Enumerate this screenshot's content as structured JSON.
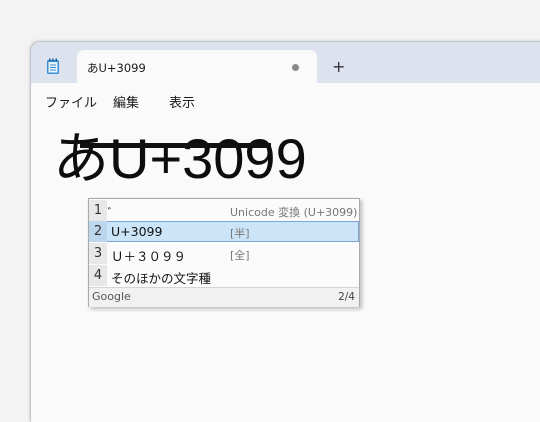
{
  "tab": {
    "title": "あU+3099",
    "new_tab_label": "+"
  },
  "menu": [
    "ファイル",
    "編集",
    "表示"
  ],
  "editor": {
    "committed_text": "あ",
    "composition_text": "U+3099"
  },
  "candidates": [
    {
      "num": "1",
      "text": "゙",
      "note": "Unicode 変換 (U+3099)",
      "selected": false
    },
    {
      "num": "2",
      "text": "U+3099",
      "note": "[半]",
      "selected": true
    },
    {
      "num": "3",
      "text": "Ｕ＋３０９９",
      "note": "[全]",
      "selected": false
    },
    {
      "num": "4",
      "text": "そのほかの文字種",
      "note": "",
      "selected": false
    }
  ],
  "footer": {
    "brand": "Google",
    "page": "2/4"
  }
}
